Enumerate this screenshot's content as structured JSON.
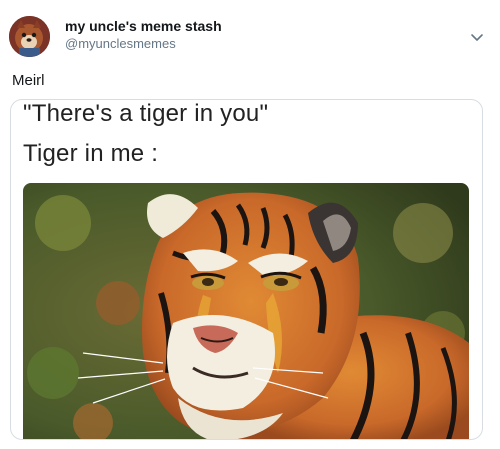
{
  "account": {
    "display_name": "my uncle's meme stash",
    "handle": "@myunclesmemes"
  },
  "tweet": {
    "text": "Meirl"
  },
  "meme": {
    "line1": "\"There's a tiger in you\"",
    "line2": "Tiger in me :"
  },
  "icons": {
    "avatar": "avatar-image",
    "menu": "chevron-down-icon"
  },
  "colors": {
    "name_text": "#14171a",
    "handle_text": "#657786",
    "card_border": "#d7dde2",
    "tiger_orange": "#d9782a"
  }
}
